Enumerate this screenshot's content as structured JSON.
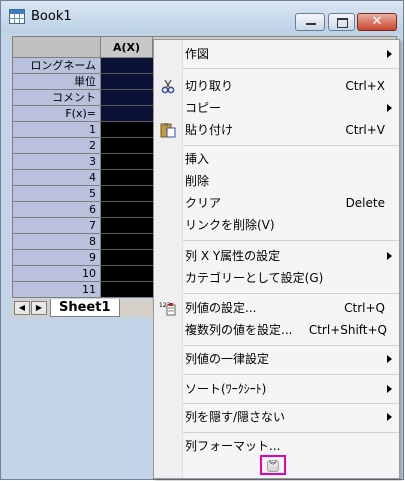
{
  "window": {
    "title": "Book1"
  },
  "grid": {
    "column_headers": [
      "A(X)"
    ],
    "row_headers": [
      "ロングネーム",
      "単位",
      "コメント",
      "F(x)=",
      "1",
      "2",
      "3",
      "4",
      "5",
      "6",
      "7",
      "8",
      "9",
      "10",
      "11"
    ]
  },
  "sheet_tabs": {
    "active": "Sheet1"
  },
  "menu": {
    "items": [
      {
        "label": "作図",
        "submenu": true
      },
      {
        "label": "切り取り",
        "shortcut": "Ctrl+X",
        "icon": "scissors-icon"
      },
      {
        "label": "コピー",
        "submenu": true
      },
      {
        "label": "貼り付け",
        "shortcut": "Ctrl+V",
        "icon": "paste-icon"
      },
      {
        "label": "挿入"
      },
      {
        "label": "削除"
      },
      {
        "label": "クリア",
        "shortcut": "Delete"
      },
      {
        "label": "リンクを削除(V)"
      },
      {
        "label": "列 X Y属性の設定",
        "submenu": true
      },
      {
        "label": "カテゴリーとして設定(G)"
      },
      {
        "label": "列値の設定...",
        "shortcut": "Ctrl+Q",
        "icon": "set-column-values-icon",
        "icon_text": "123"
      },
      {
        "label": "複数列の値を設定...",
        "shortcut": "Ctrl+Shift+Q"
      },
      {
        "label": "列値の一律設定",
        "submenu": true
      },
      {
        "label": "ソート(ﾜｰｸｼｰﾄ)",
        "submenu": true
      },
      {
        "label": "列を隠す/隠さない",
        "submenu": true
      },
      {
        "label": "列フォーマット..."
      }
    ],
    "expand_icon": "double-chevron-down-icon",
    "highlight_color": "#e000c8"
  }
}
